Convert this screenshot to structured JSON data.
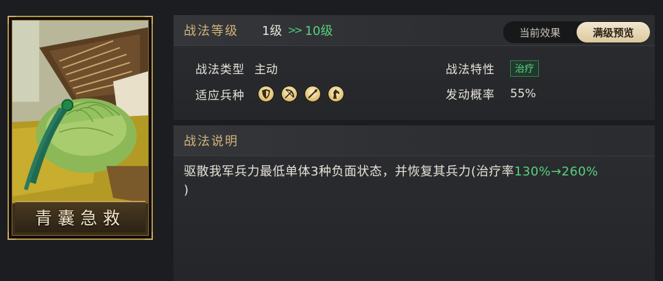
{
  "card": {
    "name": "青囊急救"
  },
  "header": {
    "title": "战法等级",
    "level_from": "1级",
    "level_arrow": ">>",
    "level_to": "10级",
    "toggle": {
      "current_label": "当前效果",
      "full_label": "满级预览",
      "selected": "满级预览"
    }
  },
  "info": {
    "type_label": "战法类型",
    "type_value": "主动",
    "trait_label": "战法特性",
    "trait_value": "治疗",
    "troops_label": "适应兵种",
    "troops": [
      {
        "icon": "shield-icon"
      },
      {
        "icon": "bow-icon"
      },
      {
        "icon": "spear-icon"
      },
      {
        "icon": "horse-icon"
      }
    ],
    "chance_label": "发动概率",
    "chance_value": "55%"
  },
  "description": {
    "title": "战法说明",
    "text_before": "驱散我军兵力最低单体3种负面状态，并恢复其兵力(治疗率",
    "rate_from": "130%",
    "rate_arrow": "→",
    "rate_to": "260%",
    "text_after": ")"
  },
  "colors": {
    "gold": "#d2b47a",
    "green": "#59d07f",
    "card_border": "#b99447"
  }
}
